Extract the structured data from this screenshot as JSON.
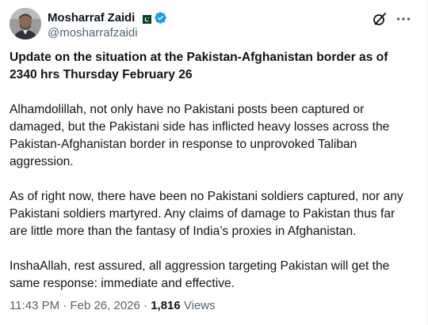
{
  "author": {
    "display_name": "Mosharraf Zaidi",
    "handle": "@mosharrafzaidi",
    "flag_icon": "pakistan-flag-icon",
    "verified_icon": "verified-badge-icon",
    "verified_color": "#1d9bf0"
  },
  "actions": {
    "grok_icon": "grok-icon",
    "more_icon": "more-options-icon"
  },
  "tweet": {
    "heading": "Update on the situation at the Pakistan-Afghanistan border as of 2340 hrs Thursday February 26",
    "paragraphs": [
      "Alhamdolillah, not only have no Pakistani posts been captured or damaged, but the Pakistani side has inflicted heavy losses across the Pakistan-Afghanistan border in response to unprovoked Taliban aggression.",
      "As of right now, there have been no Pakistani soldiers captured, nor any Pakistani soldiers martyred. Any claims of damage to Pakistan thus far are little more than the fantasy of India’s proxies in Afghanistan.",
      "InshaAllah, rest assured, all aggression targeting Pakistan will get the same response: immediate and effective."
    ]
  },
  "meta": {
    "time": "11:43 PM",
    "separator": " · ",
    "date": "Feb 26, 2026",
    "views_count": "1,816",
    "views_label": " Views"
  },
  "colors": {
    "text_primary": "#0f1419",
    "text_secondary": "#536471"
  }
}
